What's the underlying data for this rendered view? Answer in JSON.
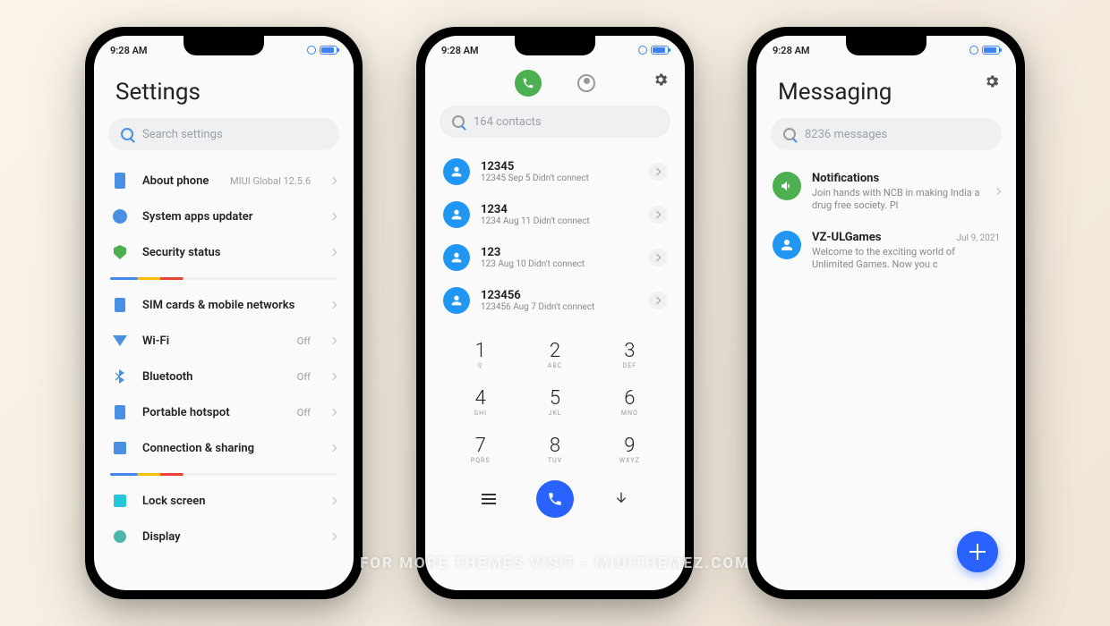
{
  "status": {
    "time": "9:28 AM"
  },
  "watermark": "FOR MORE THEMES VISIT - MIUITHEMEZ.COM",
  "settings": {
    "title": "Settings",
    "search_placeholder": "Search settings",
    "items": [
      {
        "label": "About phone",
        "value": "MIUI Global 12.5.6"
      },
      {
        "label": "System apps updater",
        "value": ""
      },
      {
        "label": "Security status",
        "value": ""
      },
      {
        "label": "SIM cards & mobile networks",
        "value": ""
      },
      {
        "label": "Wi-Fi",
        "value": "Off"
      },
      {
        "label": "Bluetooth",
        "value": "Off"
      },
      {
        "label": "Portable hotspot",
        "value": "Off"
      },
      {
        "label": "Connection & sharing",
        "value": ""
      },
      {
        "label": "Lock screen",
        "value": ""
      },
      {
        "label": "Display",
        "value": ""
      }
    ]
  },
  "phone": {
    "search_placeholder": "164 contacts",
    "calls": [
      {
        "name": "12345",
        "meta": "12345  Sep 5 Didn't connect"
      },
      {
        "name": "1234",
        "meta": "1234  Aug 11 Didn't connect"
      },
      {
        "name": "123",
        "meta": "123  Aug 10 Didn't connect"
      },
      {
        "name": "123456",
        "meta": "123456  Aug 7 Didn't connect"
      }
    ],
    "keys": [
      {
        "n": "1",
        "s": "⚲"
      },
      {
        "n": "2",
        "s": "ABC"
      },
      {
        "n": "3",
        "s": "DEF"
      },
      {
        "n": "4",
        "s": "GHI"
      },
      {
        "n": "5",
        "s": "JKL"
      },
      {
        "n": "6",
        "s": "MNO"
      },
      {
        "n": "7",
        "s": "PQRS"
      },
      {
        "n": "8",
        "s": "TUV"
      },
      {
        "n": "9",
        "s": "WXYZ"
      }
    ]
  },
  "messaging": {
    "title": "Messaging",
    "search_placeholder": "8236 messages",
    "threads": [
      {
        "title": "Notifications",
        "date": "",
        "text": "Join hands with NCB in making India a drug free society. Pl"
      },
      {
        "title": "VZ-ULGames",
        "date": "Jul 9, 2021",
        "text": "Welcome to the exciting world of Unlimited Games. Now you c"
      }
    ]
  }
}
